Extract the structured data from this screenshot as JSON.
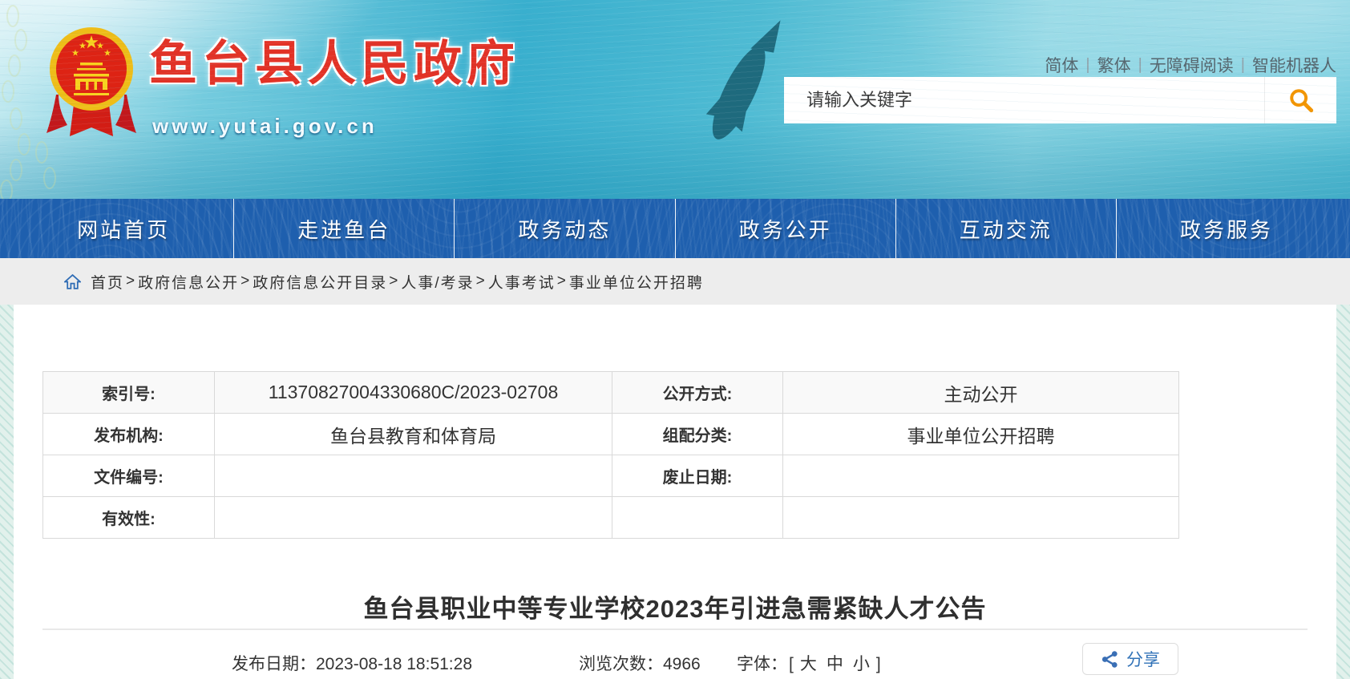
{
  "colors": {
    "nav-blue": "#1e5fae",
    "breadcrumb-bg": "#ededed",
    "title-red": "#e23226",
    "accent-orange": "#f39500",
    "link-blue": "#3273b8",
    "text-dark": "#333333"
  },
  "icons": {
    "search": "magnifier",
    "share": "share-nodes",
    "home": "house",
    "emblem": "national-emblem",
    "fish": "fish-decoration"
  },
  "header": {
    "site_title": "鱼台县人民政府",
    "site_url": "www.yutai.gov.cn",
    "link_separator": "|",
    "top_links": [
      "简体",
      "繁体",
      "无障碍阅读",
      "智能机器人"
    ],
    "search": {
      "placeholder": "请输入关键字"
    }
  },
  "nav": {
    "items": [
      "网站首页",
      "走进鱼台",
      "政务动态",
      "政务公开",
      "互动交流",
      "政务服务"
    ]
  },
  "breadcrumb": {
    "separator": ">",
    "items": [
      "首页",
      "政府信息公开",
      "政府信息公开目录",
      "人事/考录",
      "人事考试",
      "事业单位公开招聘"
    ]
  },
  "info_table": {
    "rows": [
      {
        "l1": "索引号:",
        "v1": "11370827004330680C/2023-02708",
        "l2": "公开方式:",
        "v2": "主动公开"
      },
      {
        "l1": "发布机构:",
        "v1": "鱼台县教育和体育局",
        "l2": "组配分类:",
        "v2": "事业单位公开招聘"
      },
      {
        "l1": "文件编号:",
        "v1": "",
        "l2": "废止日期:",
        "v2": ""
      },
      {
        "l1": "有效性:",
        "v1": "",
        "l2": "",
        "v2": ""
      }
    ]
  },
  "article": {
    "title": "鱼台县职业中等专业学校2023年引进急需紧缺人才公告",
    "publish_date_label": "发布日期：",
    "publish_date": "2023-08-18 18:51:28",
    "views_label": "浏览次数：",
    "views": "4966",
    "font_label": "字体：",
    "bracket_open": "[",
    "bracket_close": "]",
    "font_sizes": [
      "大",
      "中",
      "小"
    ],
    "share_label": "分享"
  }
}
